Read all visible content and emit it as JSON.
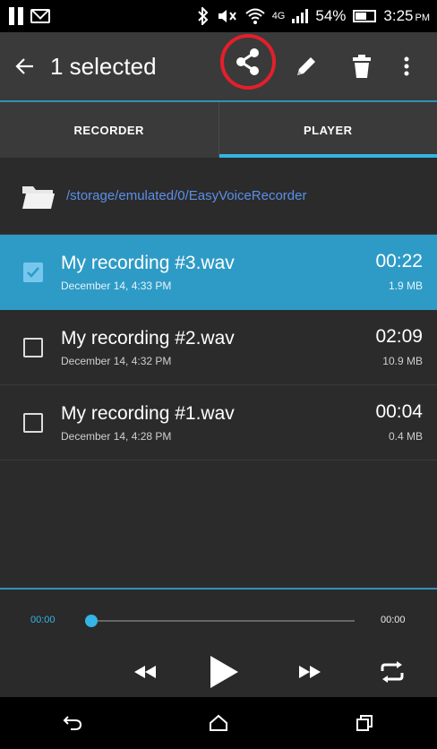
{
  "status_bar": {
    "battery": "54%",
    "time": "3:25",
    "ampm": "PM",
    "network": "4G"
  },
  "action_bar": {
    "back_icon": "arrow-left-icon",
    "title": "1 selected",
    "share_icon": "share-icon",
    "edit_icon": "pencil-icon",
    "delete_icon": "trash-icon",
    "more_icon": "more-vert-icon",
    "highlight_color": "#e41f2a"
  },
  "tabs": [
    {
      "label": "RECORDER",
      "active": false
    },
    {
      "label": "PLAYER",
      "active": true
    }
  ],
  "path": "/storage/emulated/0/EasyVoiceRecorder",
  "recordings": [
    {
      "name": "My recording #3.wav",
      "date": "December 14, 4:33 PM",
      "duration": "00:22",
      "size": "1.9 MB",
      "selected": true
    },
    {
      "name": "My recording #2.wav",
      "date": "December 14, 4:32 PM",
      "duration": "02:09",
      "size": "10.9 MB",
      "selected": false
    },
    {
      "name": "My recording #1.wav",
      "date": "December 14, 4:28 PM",
      "duration": "00:04",
      "size": "0.4 MB",
      "selected": false
    }
  ],
  "player": {
    "elapsed": "00:00",
    "total": "00:00",
    "progress": 0
  },
  "colors": {
    "accent": "#33b5e5",
    "selected_row": "#2e9bc6",
    "path_text": "#5b8fe8"
  }
}
